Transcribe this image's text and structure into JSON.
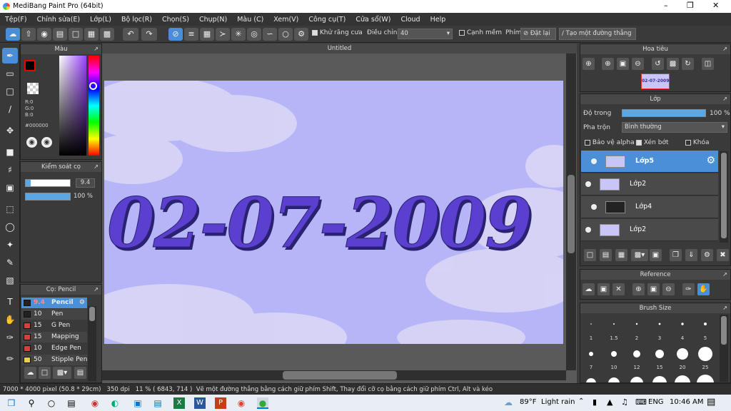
{
  "title": "MediBang Paint Pro (64bit)",
  "menu": [
    "Tệp(F)",
    "Chỉnh sửa(E)",
    "Lớp(L)",
    "Bộ lọc(R)",
    "Chọn(S)",
    "Chụp(N)",
    "Màu (C)",
    "Xem(V)",
    "Công cụ(T)",
    "Cửa sổ(W)",
    "Cloud",
    "Help"
  ],
  "toolbar": {
    "antialias_label": "Khử răng cưa",
    "adjust_label": "Điều chỉnh",
    "adjust_value": "40",
    "soft_edge_label": "Cạnh mềm",
    "key_label": "Phím",
    "reset_label": "Đặt lại",
    "straight_line_label": "Tạo một đường thẳng"
  },
  "color_panel": {
    "title": "Màu",
    "r": "R:0",
    "g": "G:0",
    "b": "B:0",
    "hex": "#000000"
  },
  "brush_control": {
    "title": "Kiểm soát cọ",
    "size": "9.4",
    "opacity": "100 %"
  },
  "brush_panel": {
    "title": "Cọ: Pencil",
    "items": [
      {
        "size": "9.4",
        "name": "Pencil",
        "color": "#222222",
        "selected": true
      },
      {
        "size": "10",
        "name": "Pen",
        "color": "#222222"
      },
      {
        "size": "15",
        "name": "G Pen",
        "color": "#e03a3a"
      },
      {
        "size": "15",
        "name": "Mapping Pe",
        "color": "#e03a3a"
      },
      {
        "size": "10",
        "name": "Edge Pen",
        "color": "#e03a3a"
      },
      {
        "size": "50",
        "name": "Stipple Pen",
        "color": "#e8d23a"
      }
    ]
  },
  "canvas": {
    "tab": "Untitled",
    "artwork_text": "02-07-2009"
  },
  "navigator": {
    "title": "Hoa tiêu",
    "thumb_text": "02-07-2009"
  },
  "layer_panel": {
    "title": "Lớp",
    "opacity_label": "Độ trong",
    "opacity_value": "100 %",
    "blend_label": "Pha trộn",
    "blend_value": "Bình thường",
    "protect_alpha": "Bảo vệ alpha",
    "clip": "Xén bớt",
    "lock": "Khóa",
    "layers": [
      {
        "name": "Lớp5",
        "selected": true
      },
      {
        "name": "Lớp2"
      },
      {
        "name": "Lớp4"
      },
      {
        "name": "Lớp2"
      }
    ]
  },
  "reference": {
    "title": "Reference"
  },
  "brush_size": {
    "title": "Brush Size",
    "sizes": [
      "1",
      "1.5",
      "2",
      "3",
      "4",
      "5",
      "7",
      "10",
      "12",
      "15",
      "20",
      "25"
    ]
  },
  "status": {
    "dims": "7000 * 4000 pixel",
    "cm": "(50.8 * 29cm)",
    "dpi": "350 dpi",
    "zoom": "11 %",
    "coords": "( 6843, 714 )",
    "hint": "Vẽ một đường thẳng bằng cách giữ phím Shift, Thay đổi cỡ cọ bằng cách giữ phím Ctrl, Alt và kéo"
  },
  "taskbar": {
    "weather_temp": "89°F",
    "weather_text": "Light rain",
    "lang": "ENG",
    "time": "10:46 AM"
  }
}
